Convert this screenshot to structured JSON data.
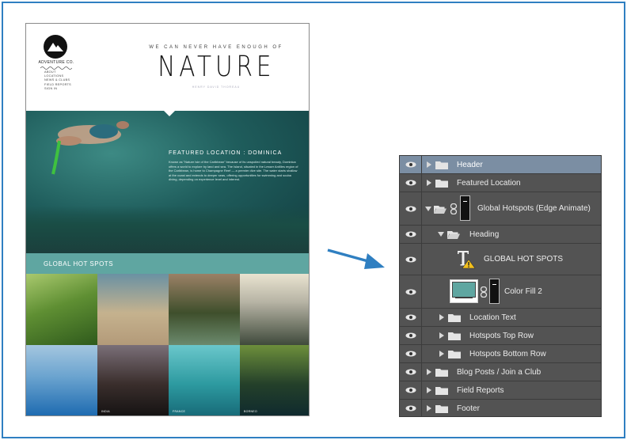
{
  "website": {
    "brand": "ADVENTURE CO.",
    "nav": [
      "ABOUT",
      "LOCATIONS",
      "NEWS & CLUBS",
      "FIELD REPORTS",
      "SIGN IN"
    ],
    "tagline": "WE CAN NEVER HAVE ENOUGH OF",
    "title": "NATURE",
    "subtag": "HENRY DAVID THOREAU",
    "featured_title": "FEATURED LOCATION : DOMINICA",
    "featured_text": "Known as \"Nature Isle of the Caribbean\" because of its unspoiled natural beauty, Dominica offers a world to explore by land and sea. The Island, situated in the Lesser Antilles region of the Caribbean, is home to Champagne Reef — a premier dive site. The water starts shallow at the coast and extends to deeper seas, offering opportunities for swimming and scuba diving, depending on experience level and interest.",
    "hot_spots_label": "GLOBAL HOT SPOTS",
    "tiles": [
      {
        "caption": ""
      },
      {
        "caption": ""
      },
      {
        "caption": ""
      },
      {
        "caption": ""
      },
      {
        "caption": ""
      },
      {
        "caption": "INDIA"
      },
      {
        "caption": "FRANCE"
      },
      {
        "caption": "BORNEO"
      }
    ]
  },
  "layers": {
    "rows": [
      {
        "label": "Header"
      },
      {
        "label": "Featured Location"
      },
      {
        "label": "Global Hotspots (Edge Animate)"
      },
      {
        "label": "Heading"
      },
      {
        "label": "GLOBAL HOT SPOTS"
      },
      {
        "label": "Color Fill 2"
      },
      {
        "label": "Location Text"
      },
      {
        "label": "Hotspots Top Row"
      },
      {
        "label": "Hotspots Bottom Row"
      },
      {
        "label": "Blog Posts / Join a Club"
      },
      {
        "label": "Field Reports"
      },
      {
        "label": "Footer"
      }
    ],
    "selected_row": "Header",
    "fill_color": "#5fa6a1"
  },
  "colors": {
    "frame": "#2f7fc1",
    "arrow": "#2f7fc1",
    "panel_bg": "#535353",
    "selected_row": "#7b8ea3",
    "teal_bar": "#5fa6a1"
  }
}
